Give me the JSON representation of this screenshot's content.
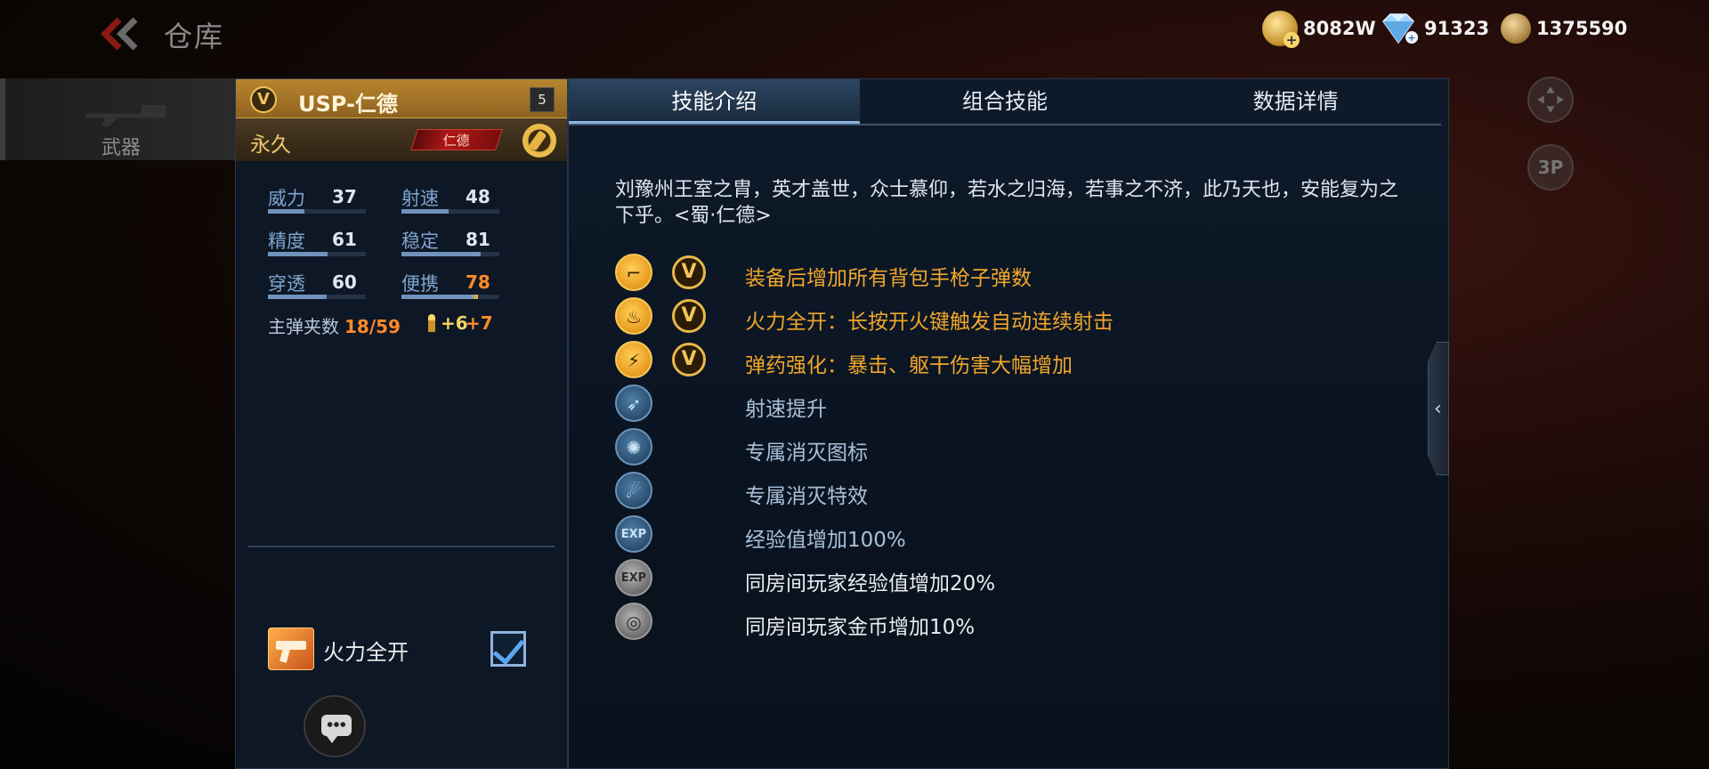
{
  "header": {
    "title": "仓库",
    "currencies": [
      {
        "icon": "gold-coin-icon",
        "value": "8082W"
      },
      {
        "icon": "diamond-icon",
        "value": "91323"
      },
      {
        "icon": "medal-icon",
        "value": "1375590"
      }
    ]
  },
  "sidebar": {
    "category_label": "武器"
  },
  "side_buttons": {
    "view_label": "3P"
  },
  "weapon": {
    "badge": "V",
    "name": "USP-仁德",
    "level": "5",
    "duration": "永久",
    "tag": "仁德",
    "stats": [
      {
        "label": "威力",
        "value": "37",
        "highlight": false,
        "fill": 0.37
      },
      {
        "label": "射速",
        "value": "48",
        "highlight": false,
        "fill": 0.48
      },
      {
        "label": "精度",
        "value": "61",
        "highlight": false,
        "fill": 0.61
      },
      {
        "label": "稳定",
        "value": "81",
        "highlight": false,
        "fill": 0.81
      },
      {
        "label": "穿透",
        "value": "60",
        "highlight": false,
        "fill": 0.6
      },
      {
        "label": "便携",
        "value": "78",
        "highlight": true,
        "fill": 0.78
      }
    ],
    "ammo_label": "主弹夹数",
    "ammo_value": "18/59",
    "ammo_bonus_1": "+6",
    "ammo_bonus_2": "+7",
    "skill_toggle_label": "火力全开",
    "skill_toggle_checked": true
  },
  "tabs": [
    {
      "label": "技能介绍",
      "active": true
    },
    {
      "label": "组合技能",
      "active": false
    },
    {
      "label": "数据详情",
      "active": false
    }
  ],
  "skills_panel": {
    "lore": "刘豫州王室之胄，英才盖世，众士慕仰，若水之归海，若事之不济，此乃天也，安能复为之下乎。<蜀·仁德>",
    "skills": [
      {
        "icon": "pistol-icon",
        "style": "gold",
        "has_v": true,
        "text": "装备后增加所有背包手枪子弹数"
      },
      {
        "icon": "flame-icon",
        "style": "gold",
        "has_v": true,
        "text": "火力全开：长按开火键触发自动连续射击"
      },
      {
        "icon": "ammo-boost-icon",
        "style": "gold",
        "has_v": true,
        "text": "弹药强化：暴击、躯干伤害大幅增加"
      },
      {
        "icon": "bullet-speed-icon",
        "style": "blue",
        "has_v": false,
        "text": "射速提升"
      },
      {
        "icon": "kill-icon-badge-icon",
        "style": "blue",
        "has_v": false,
        "text": "专属消灭图标"
      },
      {
        "icon": "kill-effect-icon",
        "style": "blue",
        "has_v": false,
        "text": "专属消灭特效"
      },
      {
        "icon": "exp-plus-icon",
        "style": "blue",
        "has_v": false,
        "text": "经验值增加100%"
      },
      {
        "icon": "room-exp-icon",
        "style": "gray",
        "has_v": false,
        "text": "同房间玩家经验值增加20%"
      },
      {
        "icon": "room-coin-icon",
        "style": "gray",
        "has_v": false,
        "text": "同房间玩家金币增加10%"
      }
    ]
  },
  "colors": {
    "gold": "#f0a62a",
    "blue_text": "#a9c0d8",
    "orange_value": "#ff8a2a"
  }
}
